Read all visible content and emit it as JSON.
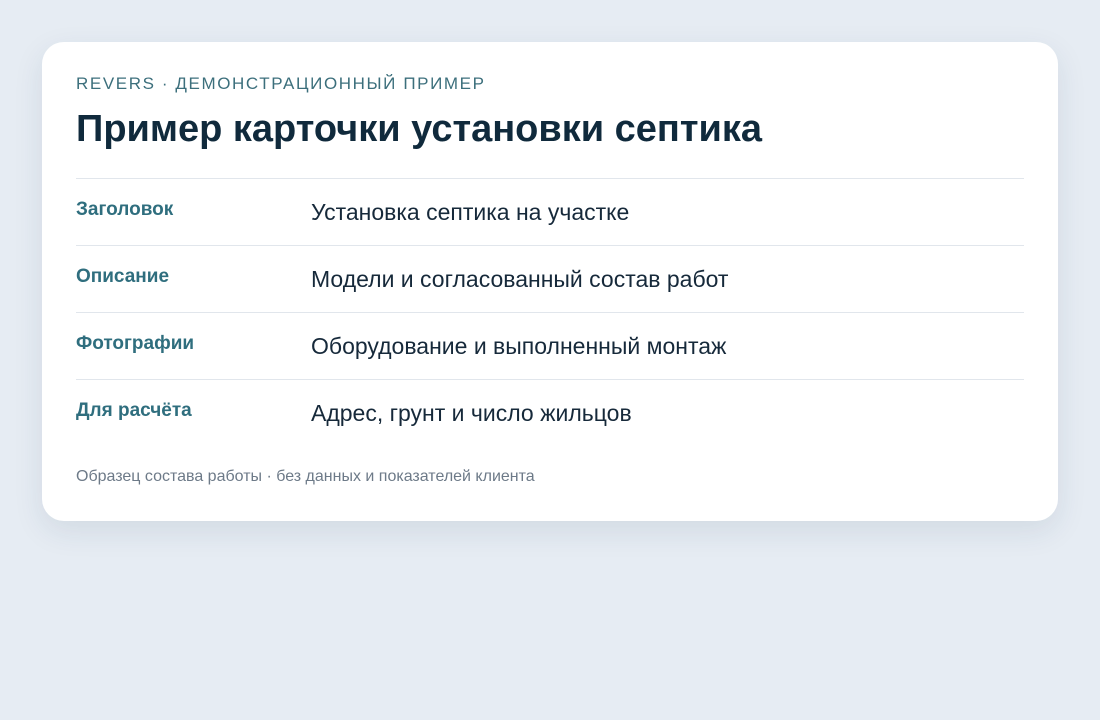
{
  "card": {
    "eyebrow": "REVERS · ДЕМОНСТРАЦИОННЫЙ ПРИМЕР",
    "title": "Пример карточки установки септика",
    "rows": [
      {
        "label": "Заголовок",
        "value": "Установка септика на участке"
      },
      {
        "label": "Описание",
        "value": "Модели и согласованный состав работ"
      },
      {
        "label": "Фотографии",
        "value": "Оборудование и выполненный монтаж"
      },
      {
        "label": "Для расчёта",
        "value": "Адрес, грунт и число жильцов"
      }
    ],
    "footnote": "Образец состава работы · без данных и показателей клиента"
  },
  "colors": {
    "background": "#e6ecf3",
    "card": "#ffffff",
    "accent": "#2f6e7e",
    "title": "#102a3c",
    "muted": "#6d7a88"
  }
}
